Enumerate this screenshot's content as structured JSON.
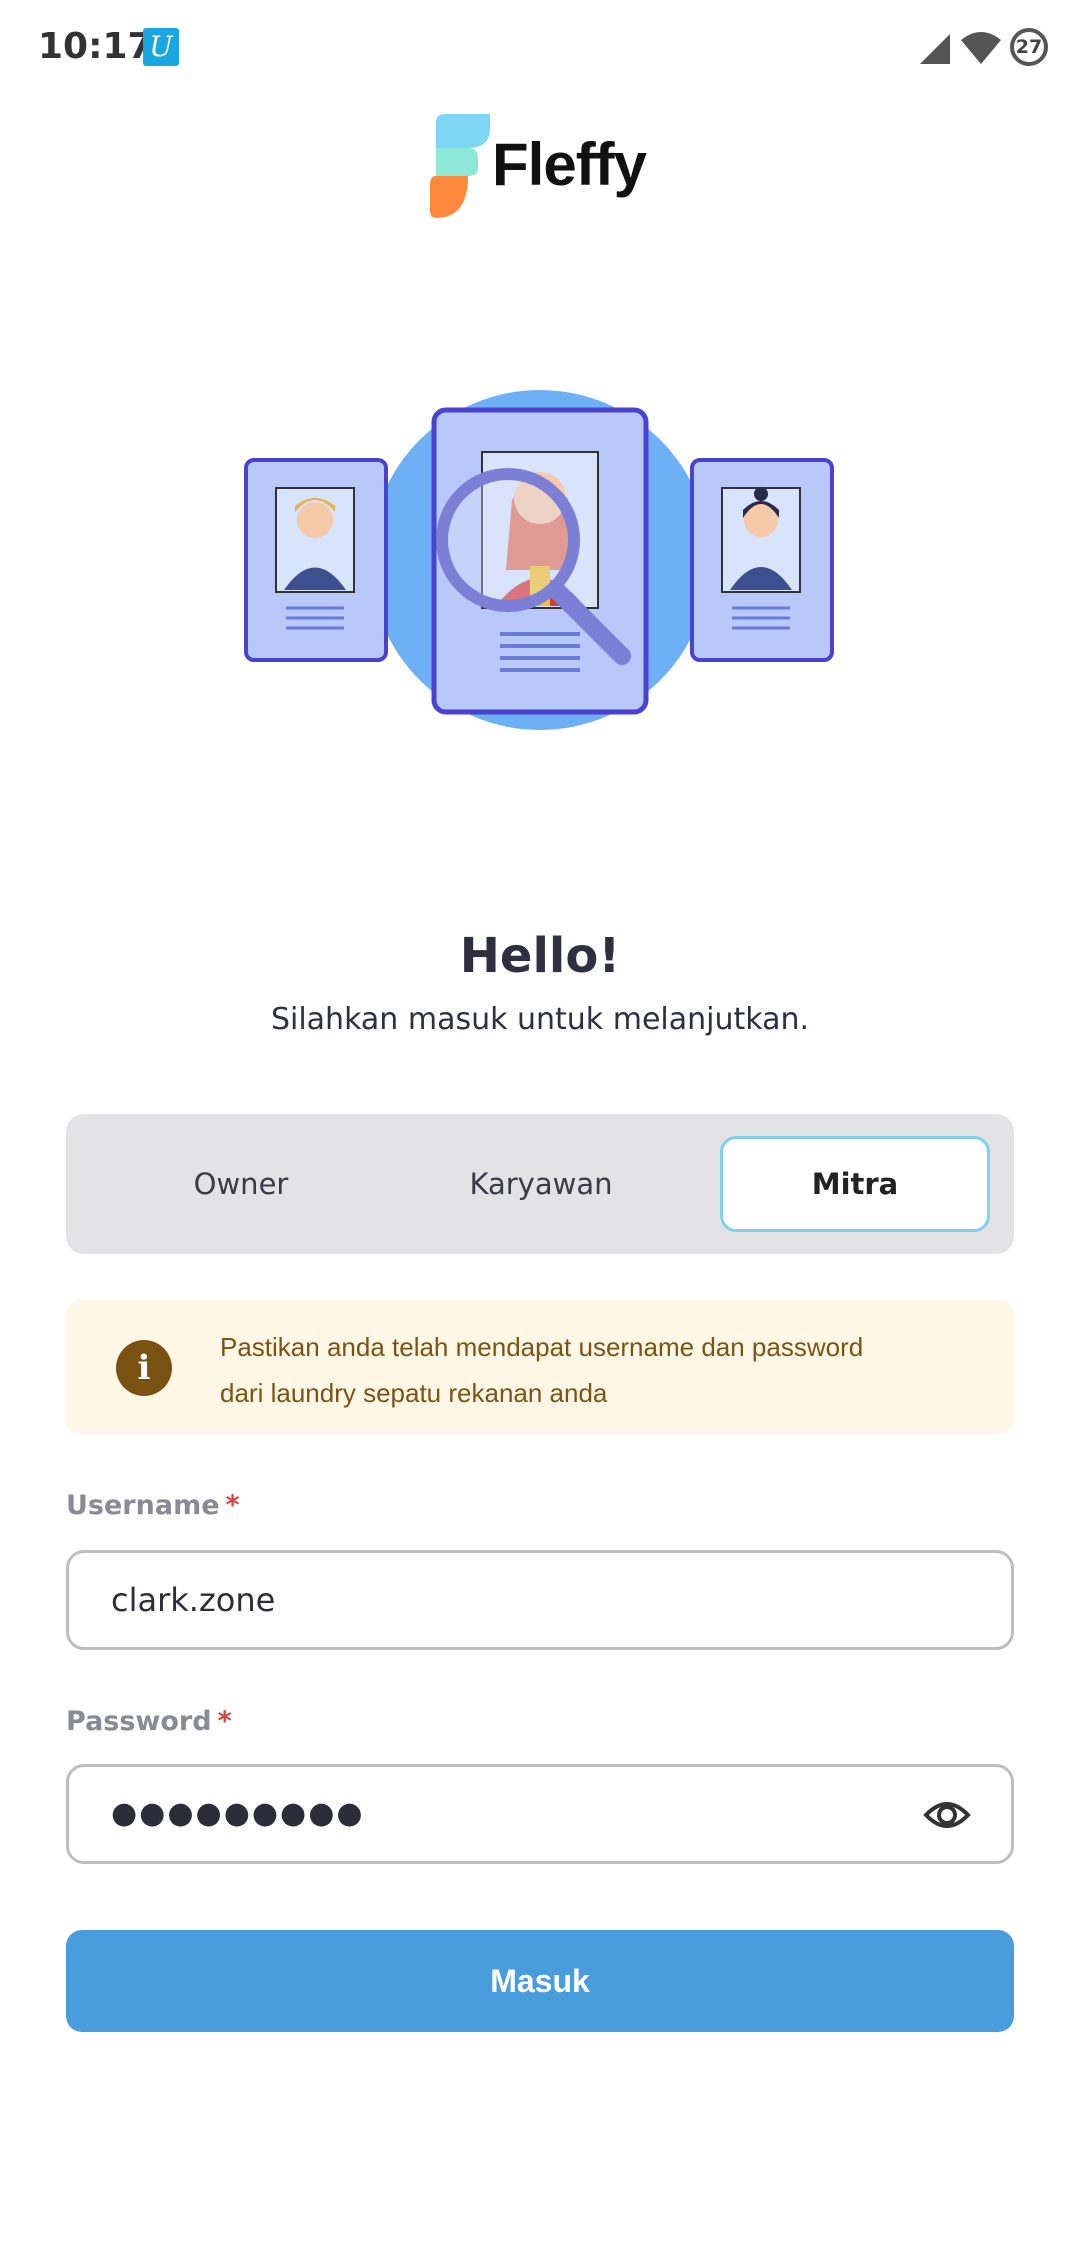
{
  "status_bar": {
    "time": "10:17",
    "notification_glyph": "U",
    "battery_level": "27",
    "icons": [
      "cell-signal-icon",
      "wifi-icon",
      "battery-icon"
    ]
  },
  "brand": {
    "name": "Fleffy",
    "logo_colors": [
      "#7dd6f5",
      "#8ee8d8",
      "#ff8a3d"
    ]
  },
  "illustration": {
    "icon": "candidate-search-illustration"
  },
  "greeting": {
    "title": "Hello!",
    "subtitle": "Silahkan masuk untuk melanjutkan."
  },
  "role_tabs": {
    "items": [
      {
        "label": "Owner",
        "selected": false
      },
      {
        "label": "Karyawan",
        "selected": false
      },
      {
        "label": "Mitra",
        "selected": true
      }
    ]
  },
  "info": {
    "icon": "info-icon",
    "line1": "Pastikan anda telah mendapat username dan password",
    "line2": "dari laundry sepatu rekanan anda"
  },
  "form": {
    "username_label": "Username",
    "username_value": "clark.zone",
    "password_label": "Password",
    "password_masked": "●●●●●●●●●",
    "required_marker": "*",
    "show_password_icon": "eye-icon"
  },
  "submit": {
    "label": "Masuk",
    "color": "#4a9ddc"
  },
  "colors": {
    "accent": "#4a9ddc",
    "tab_selected_border": "#7fd1ee",
    "info_bg": "#fff7e6",
    "info_text": "#7b5414"
  }
}
